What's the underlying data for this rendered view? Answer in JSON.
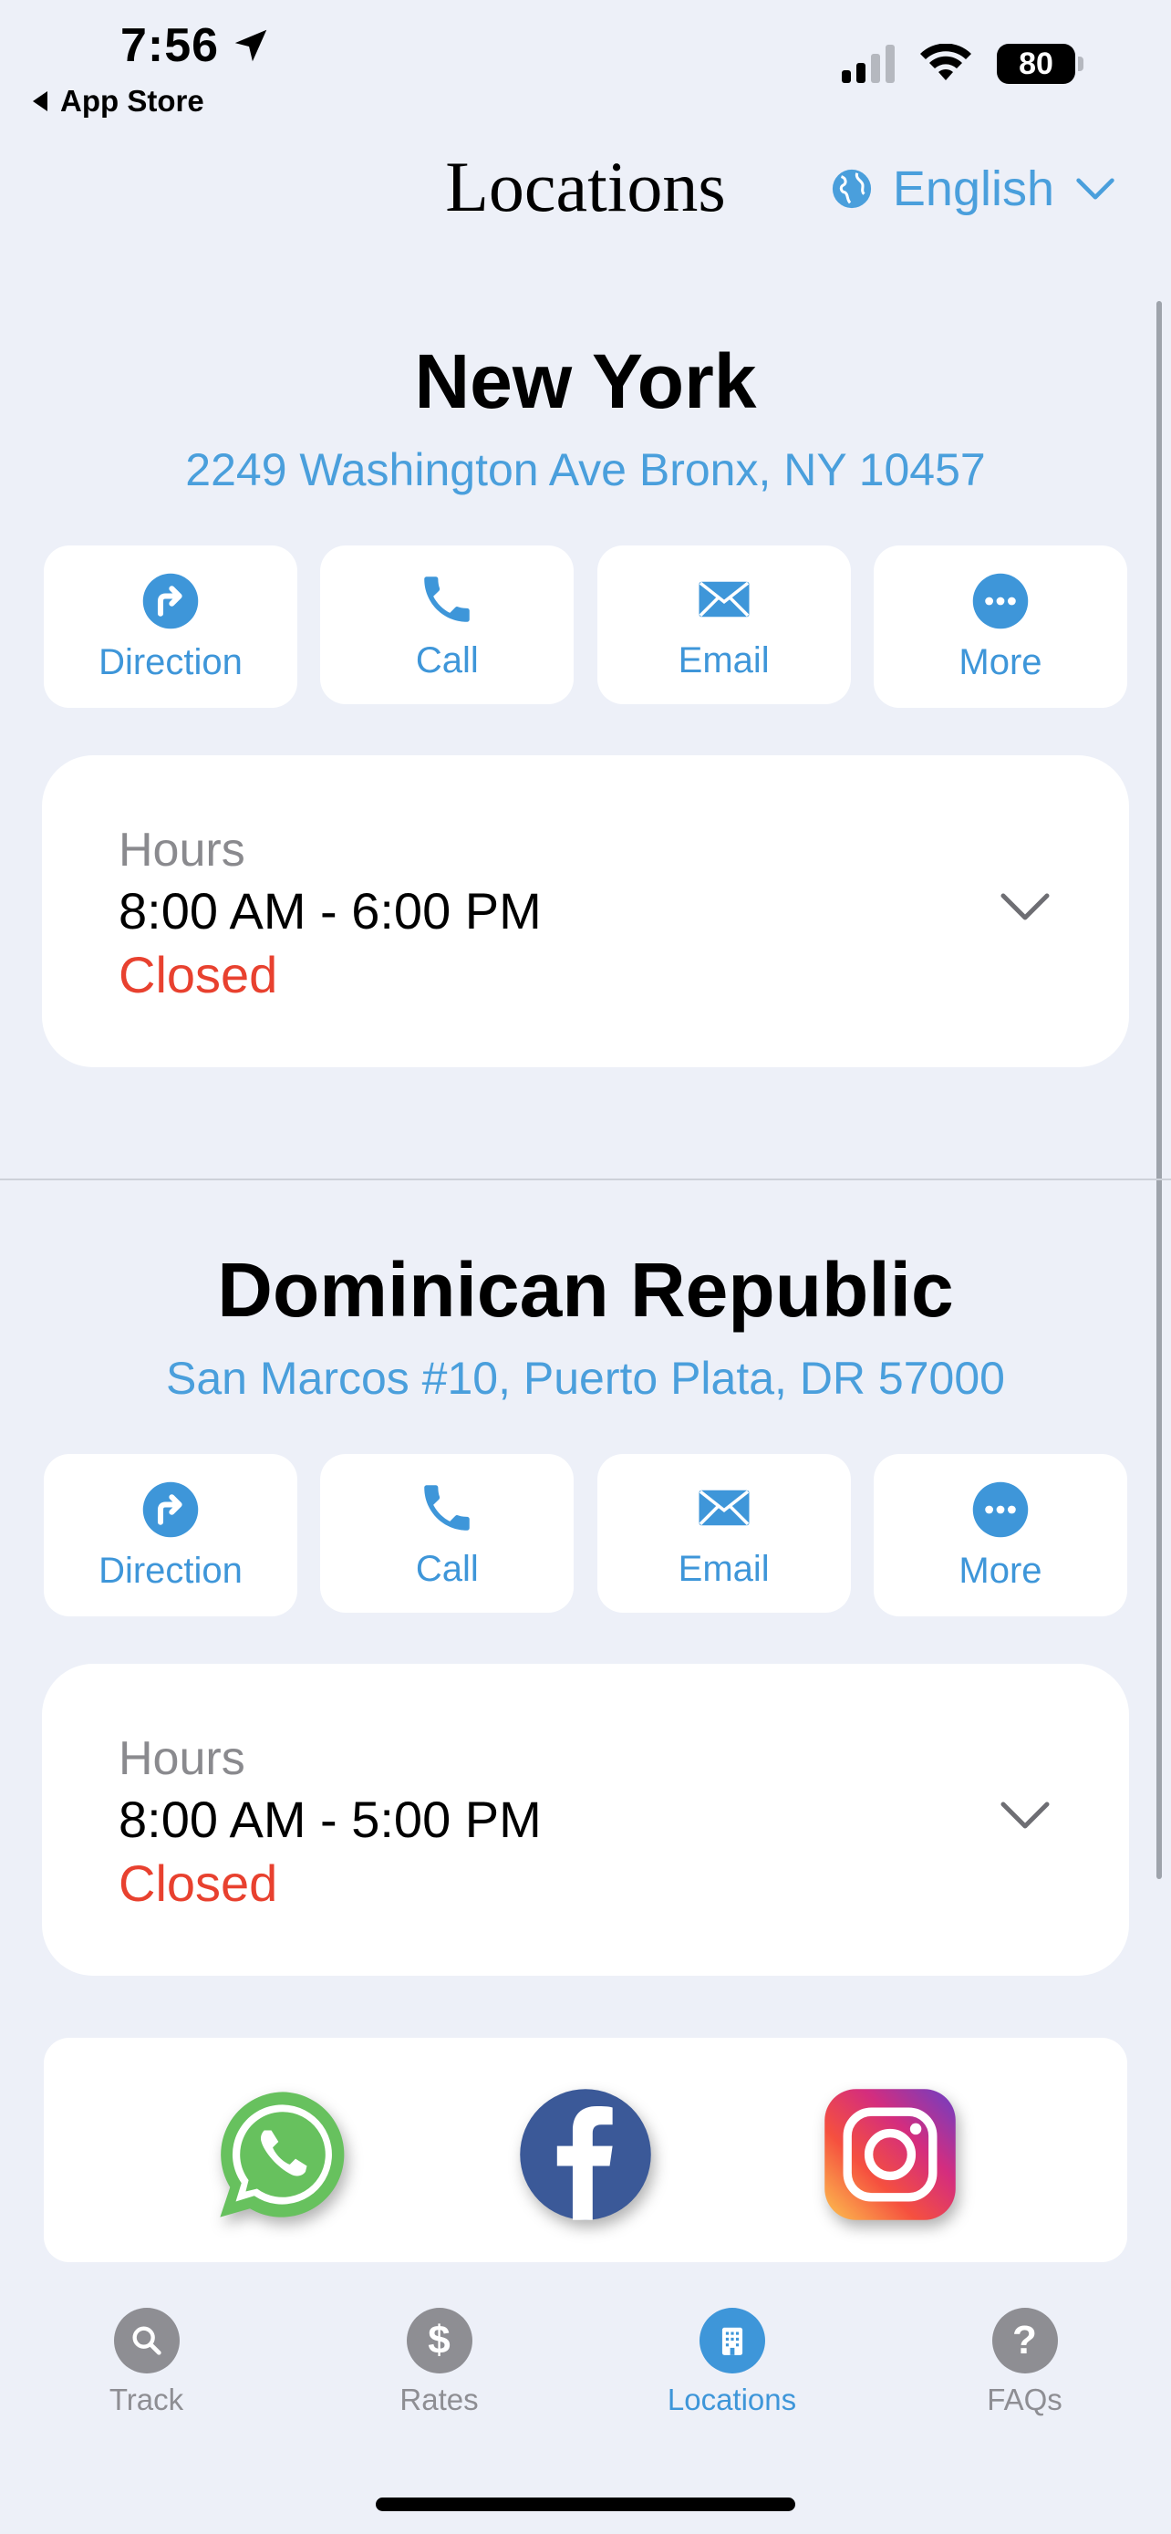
{
  "status_bar": {
    "time": "7:56",
    "back_label": "App Store",
    "battery": "80"
  },
  "header": {
    "title": "Locations",
    "language": "English"
  },
  "locations": [
    {
      "name": "New York",
      "address": "2249 Washington Ave Bronx, NY 10457",
      "actions": {
        "direction": "Direction",
        "call": "Call",
        "email": "Email",
        "more": "More"
      },
      "hours": {
        "label": "Hours",
        "time": "8:00 AM - 6:00 PM",
        "status": "Closed"
      }
    },
    {
      "name": "Dominican Republic",
      "address": "San Marcos #10, Puerto Plata, DR 57000",
      "actions": {
        "direction": "Direction",
        "call": "Call",
        "email": "Email",
        "more": "More"
      },
      "hours": {
        "label": "Hours",
        "time": "8:00 AM - 5:00 PM",
        "status": "Closed"
      }
    }
  ],
  "social": [
    "whatsapp-icon",
    "facebook-icon",
    "instagram-icon"
  ],
  "tabs": [
    {
      "label": "Track",
      "icon": "search-icon"
    },
    {
      "label": "Rates",
      "icon": "dollar-icon"
    },
    {
      "label": "Locations",
      "icon": "building-icon",
      "active": true
    },
    {
      "label": "FAQs",
      "icon": "question-icon"
    }
  ],
  "colors": {
    "accent": "#3E96D9",
    "closed": "#E8412F",
    "background": "#EDF0F8"
  }
}
